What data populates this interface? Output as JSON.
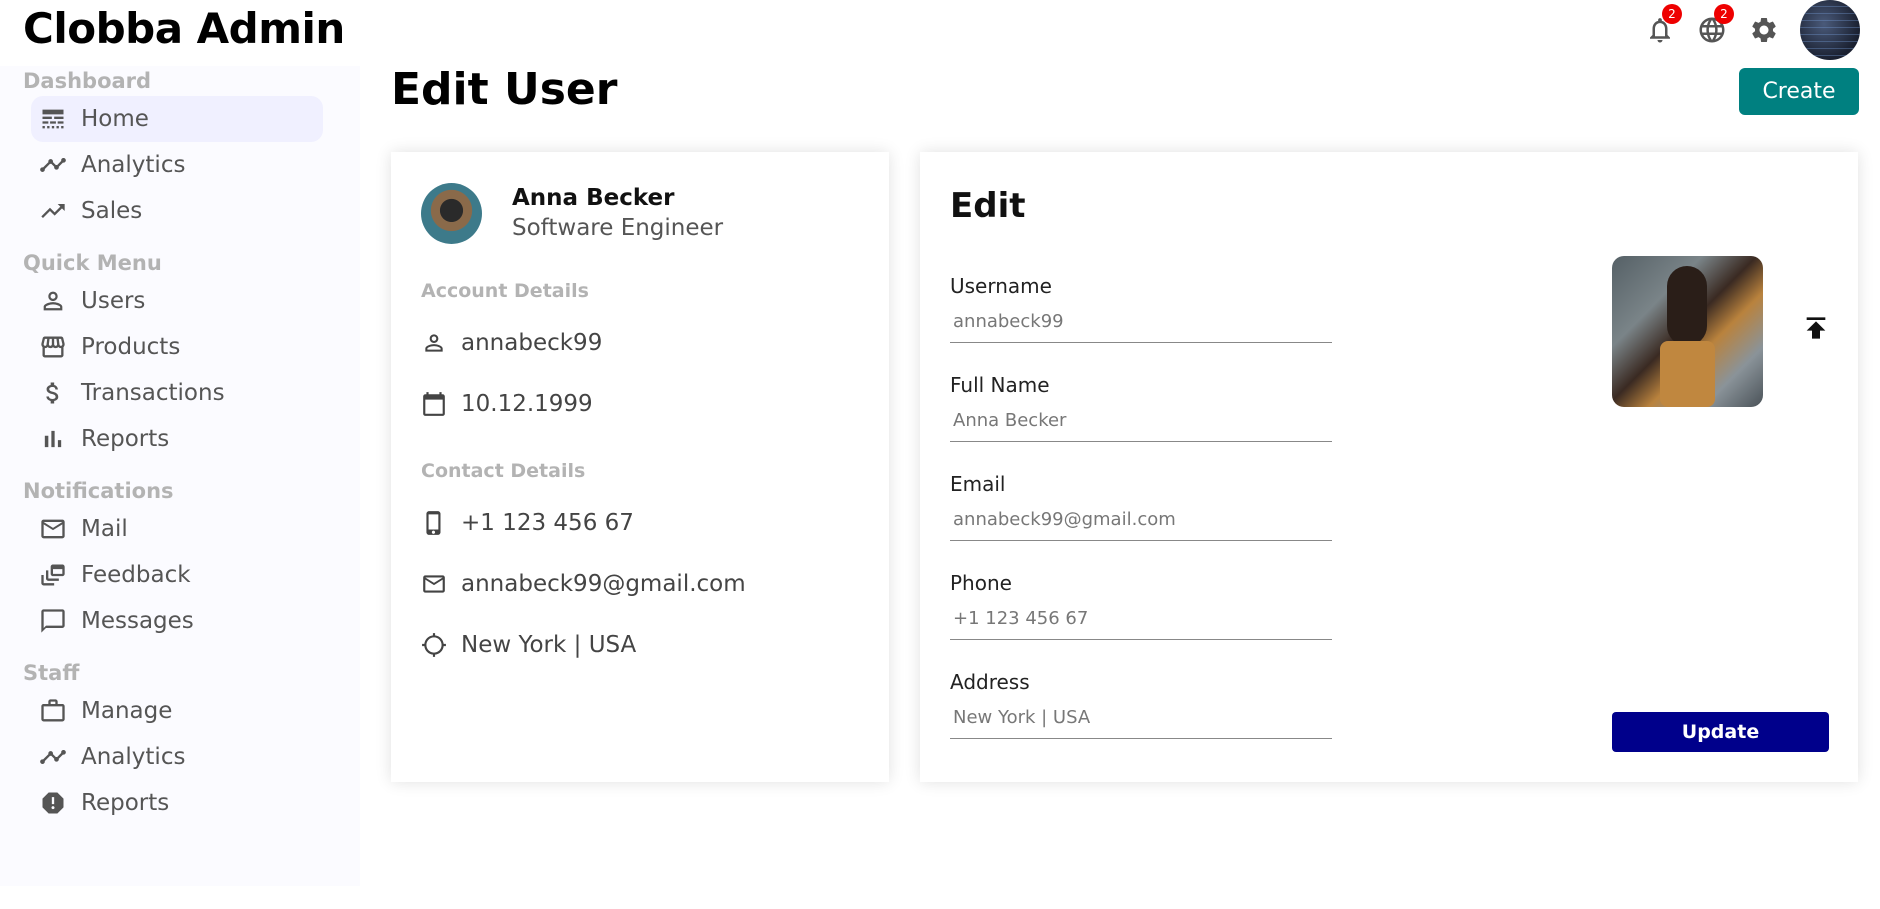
{
  "app": {
    "title": "Clobba Admin"
  },
  "topbar": {
    "notifications_badge": "2",
    "language_badge": "2"
  },
  "sidebar": {
    "groups": [
      {
        "title": "Dashboard",
        "items": [
          {
            "label": "Home",
            "icon": "line-style-icon",
            "active": true
          },
          {
            "label": "Analytics",
            "icon": "timeline-icon"
          },
          {
            "label": "Sales",
            "icon": "trending-up-icon"
          }
        ]
      },
      {
        "title": "Quick Menu",
        "items": [
          {
            "label": "Users",
            "icon": "person-outline-icon"
          },
          {
            "label": "Products",
            "icon": "storefront-icon"
          },
          {
            "label": "Transactions",
            "icon": "dollar-icon"
          },
          {
            "label": "Reports",
            "icon": "bar-chart-icon"
          }
        ]
      },
      {
        "title": "Notifications",
        "items": [
          {
            "label": "Mail",
            "icon": "mail-outline-icon"
          },
          {
            "label": "Feedback",
            "icon": "dynamic-feed-icon"
          },
          {
            "label": "Messages",
            "icon": "chat-bubble-outline-icon"
          }
        ]
      },
      {
        "title": "Staff",
        "items": [
          {
            "label": "Manage",
            "icon": "work-outline-icon"
          },
          {
            "label": "Analytics",
            "icon": "timeline-icon"
          },
          {
            "label": "Reports",
            "icon": "report-icon"
          }
        ]
      }
    ]
  },
  "main": {
    "title": "Edit User",
    "create_label": "Create"
  },
  "show": {
    "name": "Anna Becker",
    "job": "Software Engineer",
    "account_title": "Account Details",
    "username": "annabeck99",
    "birthday": "10.12.1999",
    "contact_title": "Contact Details",
    "phone": "+1 123 456 67",
    "email": "annabeck99@gmail.com",
    "address": "New York | USA"
  },
  "edit": {
    "title": "Edit",
    "fields": [
      {
        "label": "Username",
        "placeholder": "annabeck99"
      },
      {
        "label": "Full Name",
        "placeholder": "Anna Becker"
      },
      {
        "label": "Email",
        "placeholder": "annabeck99@gmail.com"
      },
      {
        "label": "Phone",
        "placeholder": "+1 123 456 67"
      },
      {
        "label": "Address",
        "placeholder": "New York | USA"
      }
    ],
    "update_label": "Update"
  },
  "colors": {
    "accent_create": "#008080",
    "accent_update": "#00008b",
    "badge": "#ee0000",
    "sidebar_bg": "#fbfbff",
    "active_item_bg": "#f0f0ff"
  }
}
